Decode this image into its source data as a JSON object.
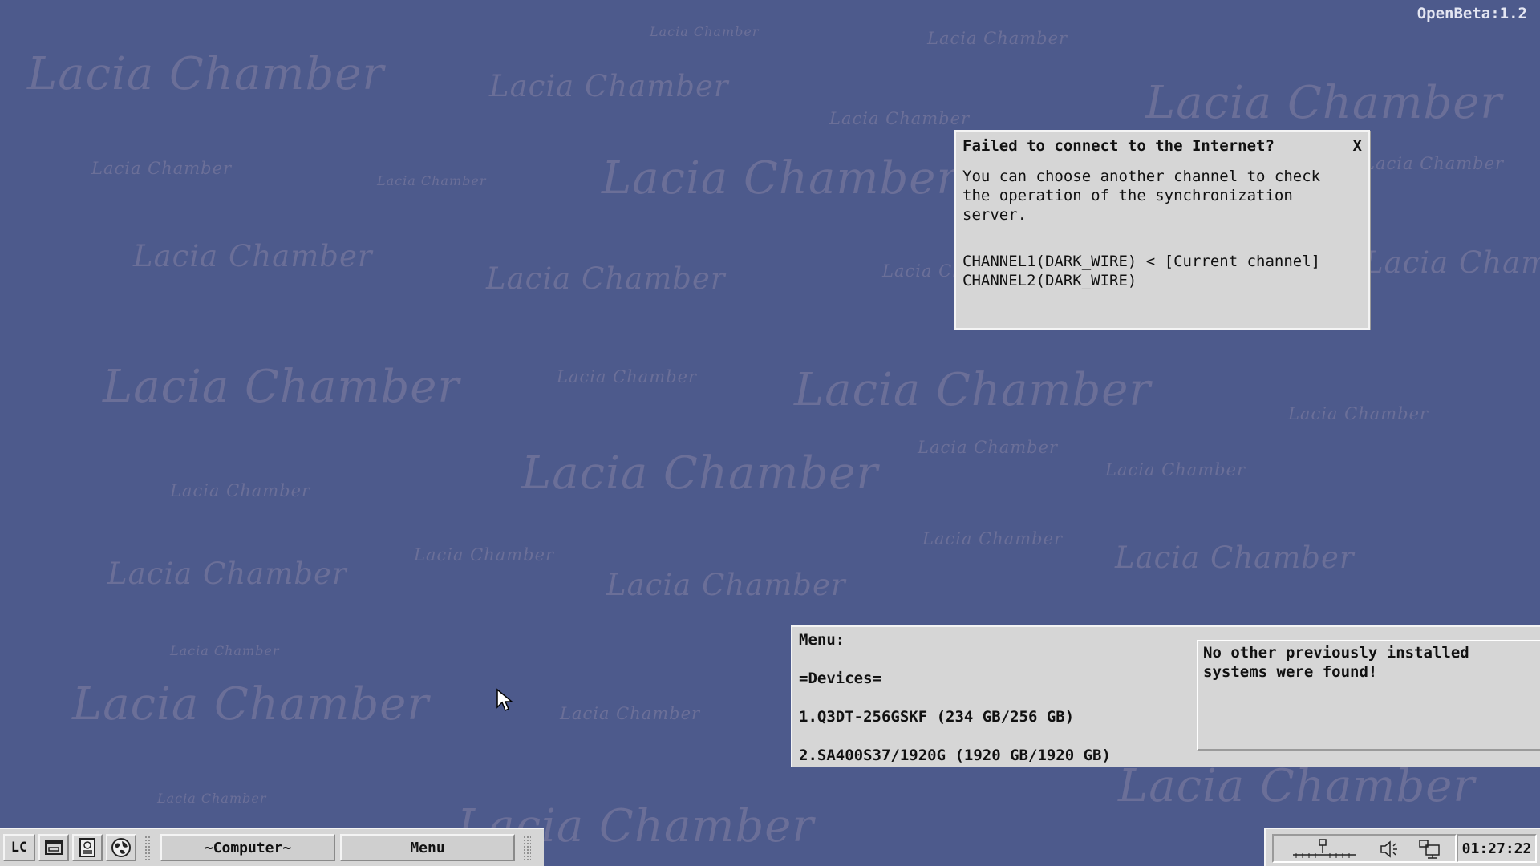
{
  "watermark_text": "Lacia Chamber",
  "version_label": "OpenBeta:1.2",
  "dialog": {
    "title": "Failed to connect to the Internet?",
    "close_label": "X",
    "message_lines": [
      "You can choose another channel to check",
      "the operation of the synchronization",
      "server."
    ],
    "channels": [
      "CHANNEL1(DARK_WIRE) < [Current channel]",
      "CHANNEL2(DARK_WIRE)"
    ]
  },
  "menu_panel": {
    "header": "Menu:",
    "section": "=Devices=",
    "devices": [
      "1.Q3DT-256GSKF (234 GB/256 GB)",
      "2.SA400S37/1920G (1920 GB/1920 GB)"
    ],
    "info_lines": [
      "No other previously installed",
      "systems were found!"
    ]
  },
  "taskbar": {
    "start_label": "LC",
    "launchers": [
      "window-icon",
      "document-icon",
      "globe-icon"
    ],
    "tasks": [
      "~Computer~",
      "Menu"
    ]
  },
  "tray": {
    "icons": [
      "network-icon",
      "volume-icon",
      "display-icon"
    ],
    "clock": "01:27:22"
  },
  "colors": {
    "desktop": "#4d5a8c",
    "panel": "#d6d6d6",
    "watermark": "#6b6f98"
  }
}
